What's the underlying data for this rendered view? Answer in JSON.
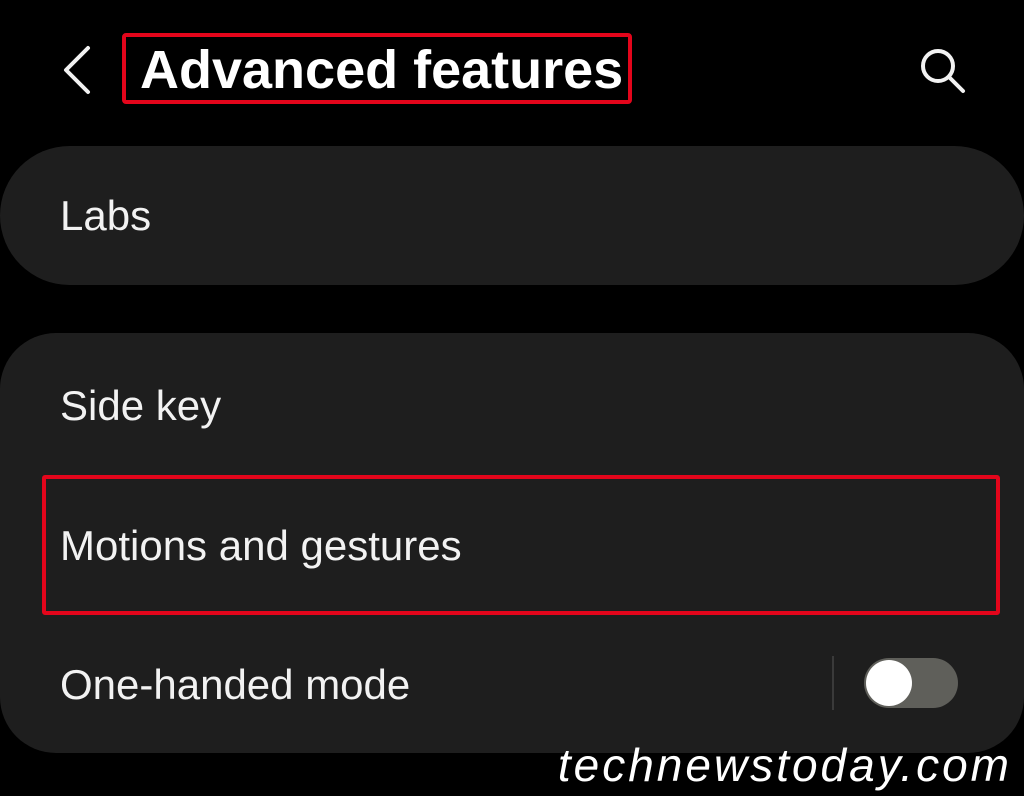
{
  "header": {
    "title": "Advanced features",
    "back_icon": "chevron-left-icon",
    "search_icon": "search-icon"
  },
  "sections": {
    "labs": {
      "label": "Labs"
    },
    "side_key": {
      "label": "Side key"
    },
    "motions": {
      "label": "Motions and gestures"
    },
    "one_handed": {
      "label": "One-handed mode",
      "toggle_on": false
    }
  },
  "colors": {
    "background": "#000000",
    "card": "#1e1e1e",
    "highlight": "#e3051b",
    "toggle_track": "#5f5f5a"
  },
  "watermark": {
    "text": "technewstoday.com"
  }
}
